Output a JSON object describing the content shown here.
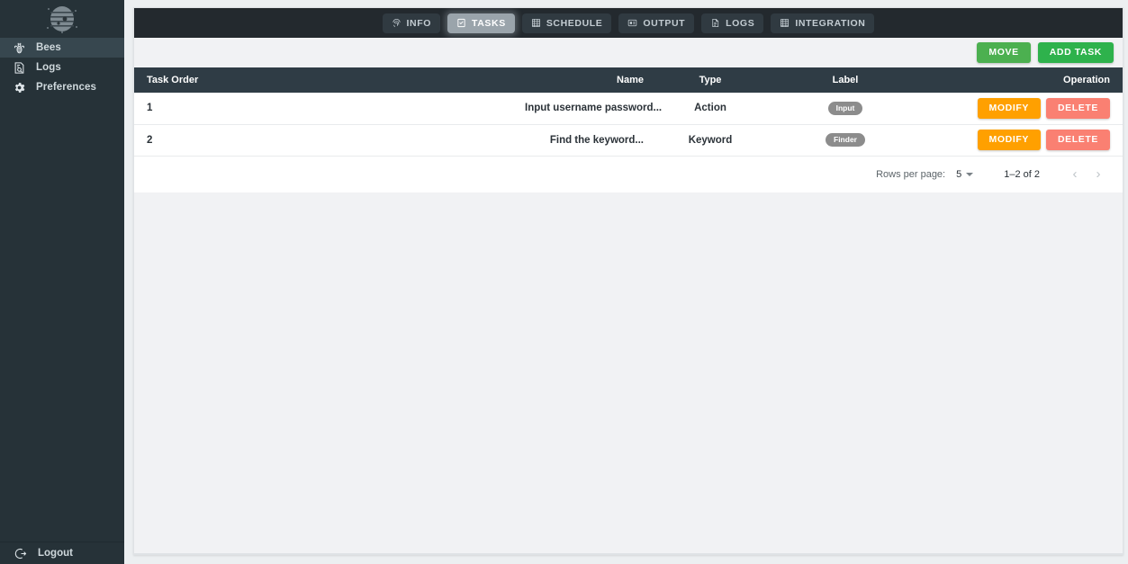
{
  "sidebar": {
    "logo_name": "beehive-logo",
    "items": [
      {
        "label": "Bees",
        "icon": "bee-icon",
        "active": true
      },
      {
        "label": "Logs",
        "icon": "log-search-icon",
        "active": false
      },
      {
        "label": "Preferences",
        "icon": "gear-icon",
        "active": false
      }
    ],
    "logout": {
      "label": "Logout",
      "icon": "logout-icon"
    }
  },
  "tabs": [
    {
      "label": "INFO",
      "icon": "fingerprint-icon",
      "active": false
    },
    {
      "label": "TASKS",
      "icon": "checklist-icon",
      "active": true
    },
    {
      "label": "SCHEDULE",
      "icon": "abacus-icon",
      "active": false
    },
    {
      "label": "OUTPUT",
      "icon": "monitor-icon",
      "active": false
    },
    {
      "label": "LOGS",
      "icon": "document-icon",
      "active": false
    },
    {
      "label": "INTEGRATION",
      "icon": "abacus-icon",
      "active": false
    }
  ],
  "toolbar": {
    "move_label": "MOVE",
    "add_task_label": "ADD TASK"
  },
  "table": {
    "columns": [
      "Task Order",
      "Name",
      "Type",
      "Label",
      "Operation"
    ],
    "rows": [
      {
        "order": "1",
        "name": "Input username password...",
        "type": "Action",
        "label": "Input",
        "modify_label": "MODIFY",
        "delete_label": "DELETE"
      },
      {
        "order": "2",
        "name": "Find the keyword...",
        "type": "Keyword",
        "label": "Finder",
        "modify_label": "MODIFY",
        "delete_label": "DELETE"
      }
    ]
  },
  "pagination": {
    "rows_per_page_label": "Rows per page:",
    "rows_per_page_value": "5",
    "range_label": "1–2 of 2",
    "prev_label": "‹",
    "next_label": "›"
  },
  "colors": {
    "sidebar_bg": "#263238",
    "tabbar_bg": "#23292e",
    "table_header_bg": "#2f3c45",
    "move_green": "#4cb050",
    "add_green": "#2eb24c",
    "modify_orange": "#ffa000",
    "delete_red": "#fa8072",
    "chip_gray": "#8c8c8c"
  }
}
